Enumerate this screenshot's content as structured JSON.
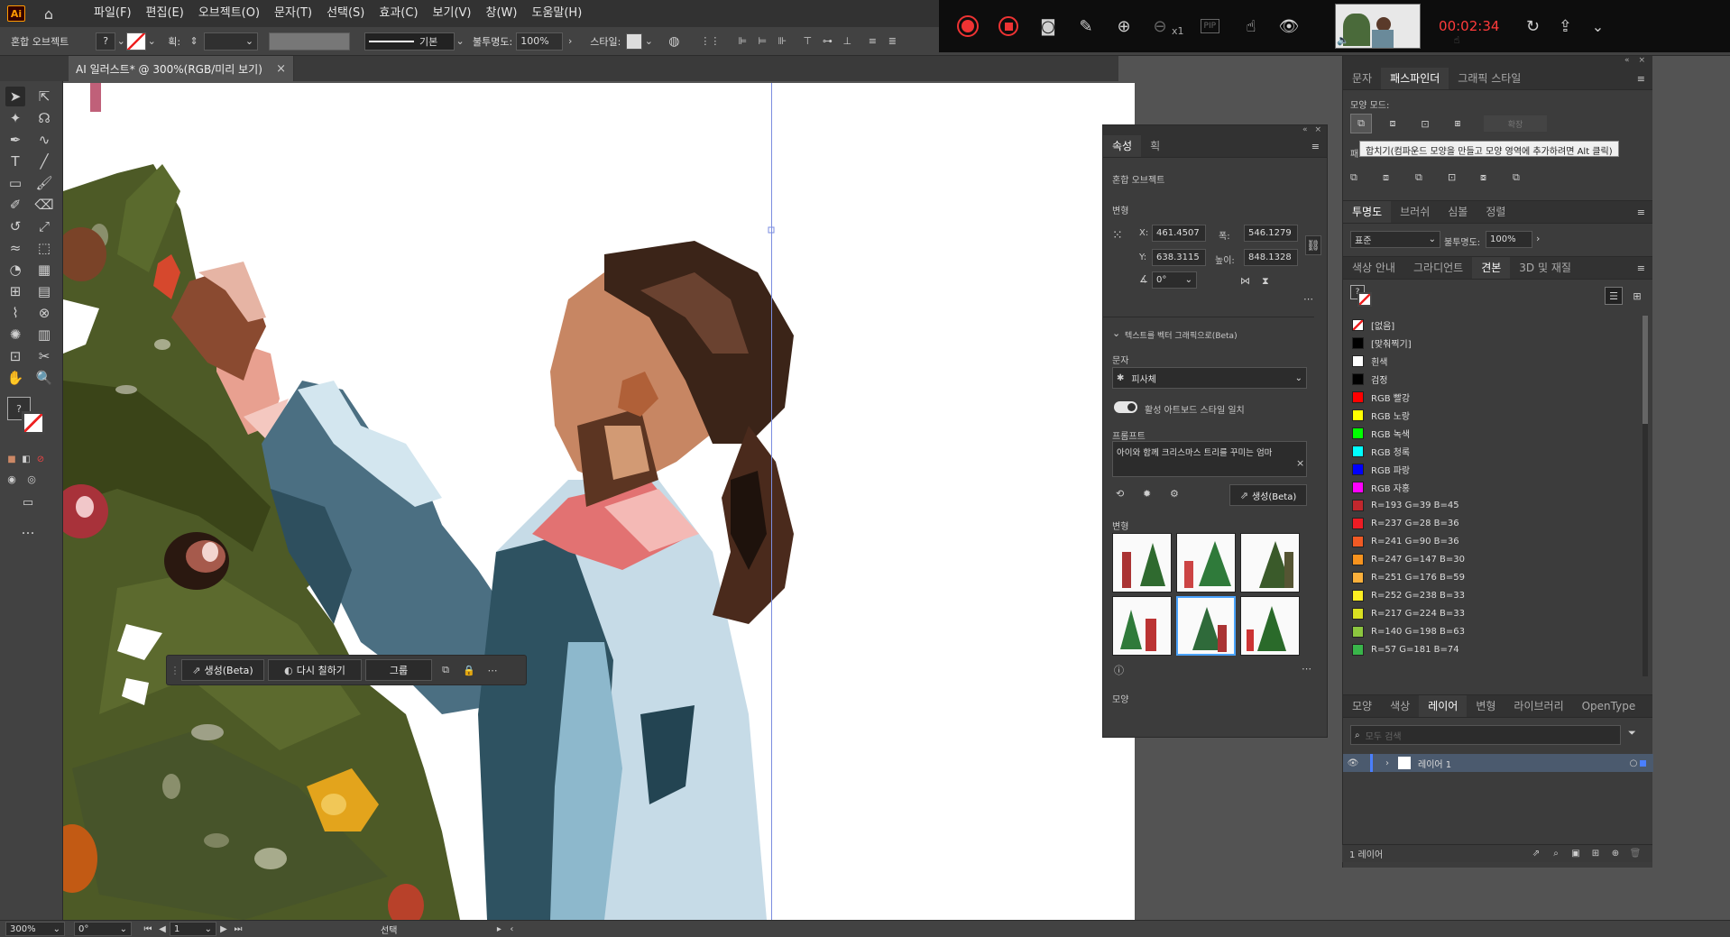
{
  "menubar": {
    "logo": "Ai",
    "items": [
      "파일(F)",
      "편집(E)",
      "오브젝트(O)",
      "문자(T)",
      "선택(S)",
      "효과(C)",
      "보기(V)",
      "창(W)",
      "도움말(H)"
    ]
  },
  "control": {
    "selection_type": "혼합 오브젝트",
    "stroke_label": "획:",
    "stroke_style": "기본",
    "opacity_label": "불투명도:",
    "opacity_value": "100%",
    "style_label": "스타일:"
  },
  "recorder": {
    "timer": "00:02:34",
    "zoom_level": "x1",
    "pip_label": "PIP"
  },
  "document": {
    "tab_title": "AI 일러스트* @ 300%(RGB/미리 보기)",
    "close": "×"
  },
  "context_bar": {
    "generate": "생성(Beta)",
    "recolor": "다시 칠하기",
    "group": "그룹"
  },
  "properties": {
    "tabs": [
      "속성",
      "획"
    ],
    "object_type": "혼합 오브젝트",
    "transform_title": "변형",
    "x_label": "X:",
    "x_value": "461.4507",
    "y_label": "Y:",
    "y_value": "638.3115",
    "w_label": "폭:",
    "w_value": "546.1279",
    "h_label": "높이:",
    "h_value": "848.1328",
    "angle_value": "0°",
    "tvg_title": "텍스트를 벡터 그래픽으로(Beta)",
    "type_label": "문자",
    "type_value": "피사체",
    "toggle_label": "활성 아트보드 스타일 일치",
    "prompt_label": "프롬프트",
    "prompt_value": "아이와 함께 크리스마스 트리를 꾸미는 엄마",
    "generate_button": "생성(Beta)",
    "variations_label": "변형",
    "appearance_label": "모양"
  },
  "pathfinder": {
    "tabs": [
      "문자",
      "패스파인더",
      "그래픽 스타일"
    ],
    "shape_modes_label": "모양 모드:",
    "expand_label": "확장",
    "pathfinders_label": "패",
    "tooltip": "합치기(컴파운드 모양을 만들고 모양 영역에 추가하려면 Alt 클릭)"
  },
  "transparency": {
    "tabs": [
      "투명도",
      "브러쉬",
      "심볼",
      "정렬"
    ],
    "blend_mode": "표준",
    "opacity_label": "불투명도:",
    "opacity_value": "100%"
  },
  "swatches": {
    "tabs": [
      "색상 안내",
      "그라디언트",
      "견본",
      "3D 및 재질"
    ],
    "items": [
      {
        "name": "[없음]",
        "color": "none"
      },
      {
        "name": "[맞춰찍기]",
        "color": "#000000"
      },
      {
        "name": "흰색",
        "color": "#ffffff"
      },
      {
        "name": "검정",
        "color": "#000000"
      },
      {
        "name": "RGB 빨강",
        "color": "#ff0000"
      },
      {
        "name": "RGB 노랑",
        "color": "#ffff00"
      },
      {
        "name": "RGB 녹색",
        "color": "#00ff00"
      },
      {
        "name": "RGB 청록",
        "color": "#00ffff"
      },
      {
        "name": "RGB 파랑",
        "color": "#0000ff"
      },
      {
        "name": "RGB 자홍",
        "color": "#ff00ff"
      },
      {
        "name": "R=193 G=39 B=45",
        "color": "#c1272d"
      },
      {
        "name": "R=237 G=28 B=36",
        "color": "#ed1c24"
      },
      {
        "name": "R=241 G=90 B=36",
        "color": "#f15a24"
      },
      {
        "name": "R=247 G=147 B=30",
        "color": "#f7931e"
      },
      {
        "name": "R=251 G=176 B=59",
        "color": "#fbb03b"
      },
      {
        "name": "R=252 G=238 B=33",
        "color": "#fcee21"
      },
      {
        "name": "R=217 G=224 B=33",
        "color": "#d9e021"
      },
      {
        "name": "R=140 G=198 B=63",
        "color": "#8cc63f"
      },
      {
        "name": "R=57 G=181 B=74",
        "color": "#39b54a"
      }
    ]
  },
  "layers": {
    "tabs": [
      "모양",
      "색상",
      "레이어",
      "변형",
      "라이브러리",
      "OpenType"
    ],
    "search_placeholder": "모두 검색",
    "layer_name": "레이어 1",
    "footer_count": "1 레이어"
  },
  "status": {
    "zoom": "300%",
    "angle": "0°",
    "artboard": "1",
    "tool": "선택"
  }
}
